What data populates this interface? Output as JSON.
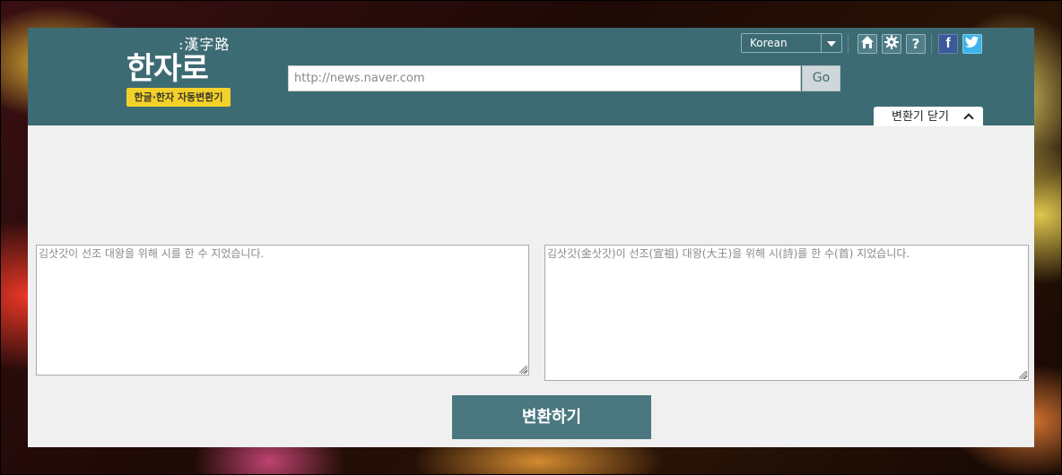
{
  "header": {
    "logo_hanja": ":漢字路",
    "logo_title": "한자로",
    "logo_badge": "한글·한자 자동변환기",
    "url_placeholder": "http://news.naver.com",
    "go_label": "Go",
    "language_selected": "Korean",
    "icons": {
      "home": "home-icon",
      "settings": "gear-icon",
      "help": "?",
      "facebook": "f",
      "twitter": "twitter-icon"
    },
    "close_converter_label": "변환기 닫기"
  },
  "converter": {
    "input_placeholder": "김삿갓이 선조 대왕을 위해 시를 한 수 지었습니다.",
    "output_placeholder": "김삿갓(金삿갓)이 선조(宣祖) 대왕(大王)을 위해 시(詩)를 한 수(首) 지었습니다.",
    "convert_label": "변환하기"
  },
  "colors": {
    "header_bg": "#3d6b74",
    "badge_bg": "#f3d12a",
    "button_bg": "#4b7880",
    "panel_bg": "#f0f0f0"
  }
}
